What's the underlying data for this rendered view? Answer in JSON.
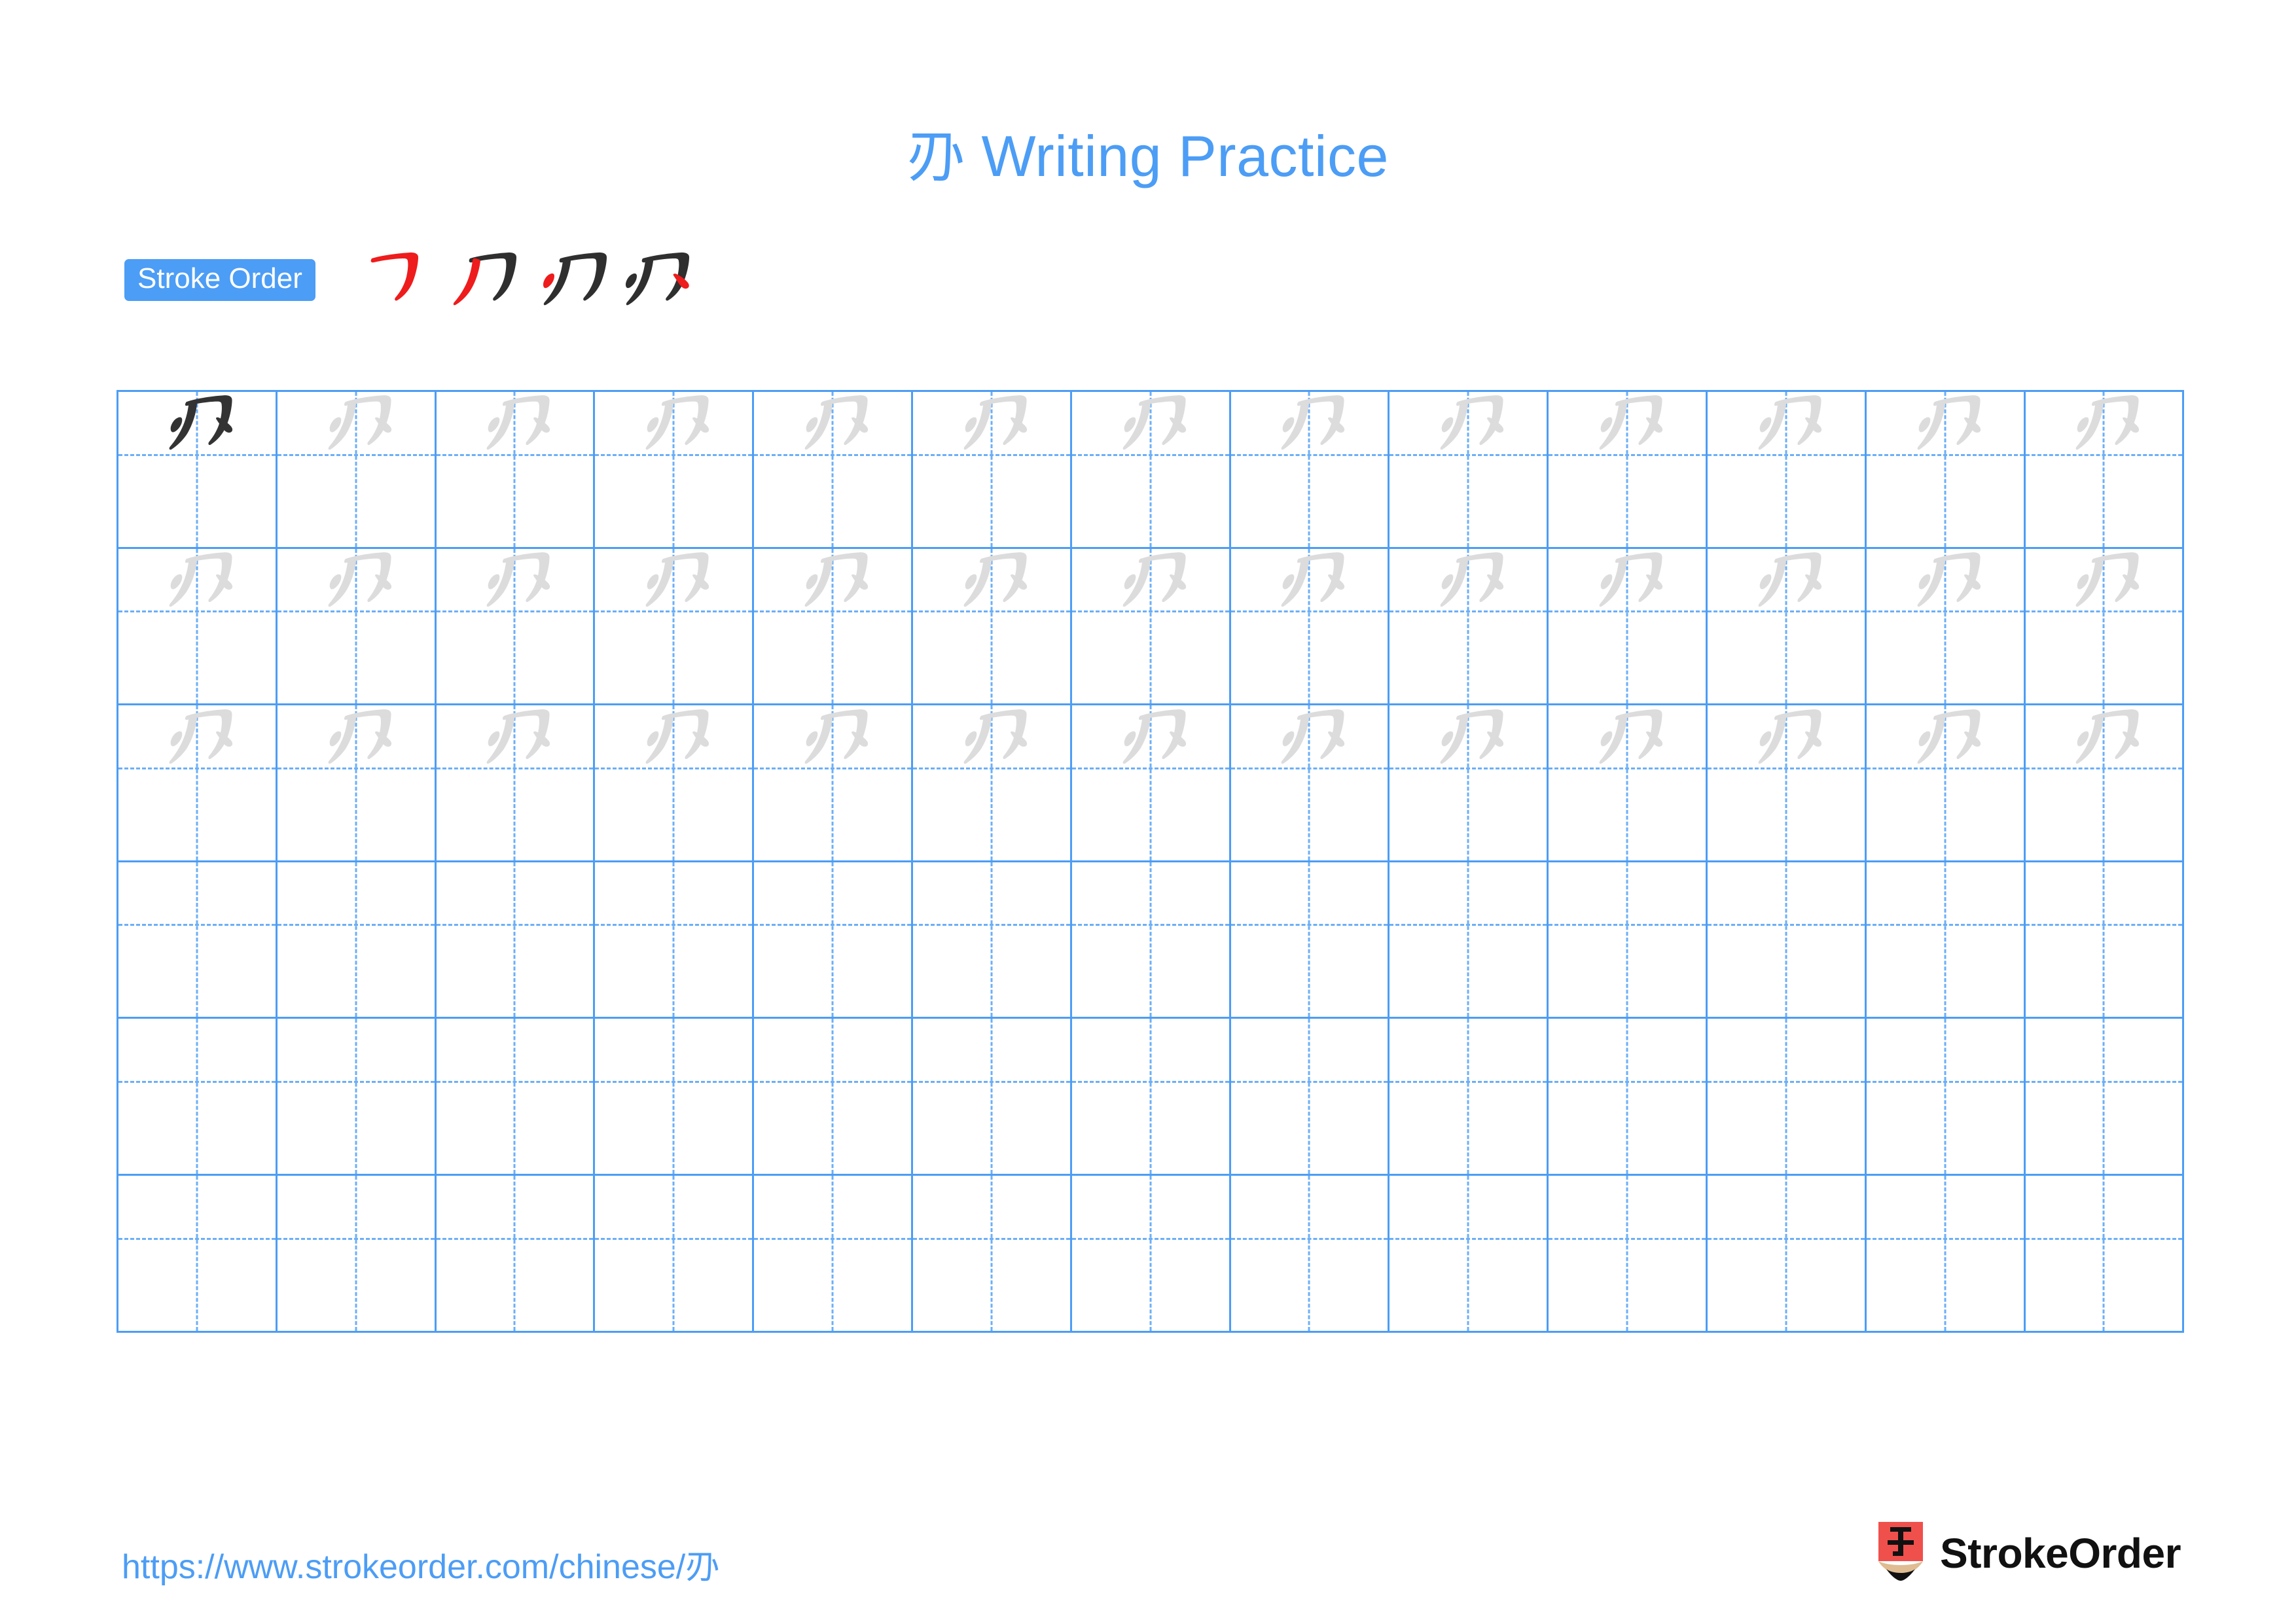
{
  "document": {
    "character": "刅",
    "title_suffix": " Writing Practice",
    "title": "刅 Writing Practice",
    "background_color": "#ffffff"
  },
  "colors": {
    "accent_blue": "#4C9DF5",
    "grid_line": "#4C9DF5",
    "grid_guide": "#6CAFF7",
    "model_char": "#333333",
    "trace_char": "#DCDCDC",
    "stroke_new": "#EE1C1C",
    "stroke_done": "#2F2F2F",
    "logo_red": "#F0504C",
    "logo_wood": "#E0BC92",
    "logo_text": "#111111"
  },
  "stroke_order": {
    "badge_label": "Stroke Order",
    "total_strokes": 4,
    "steps": [
      {
        "index": 1,
        "character": "㇀",
        "new_stroke": "heng-zhe-gou"
      },
      {
        "index": 2,
        "character": "刀",
        "new_stroke": "pie"
      },
      {
        "index": 3,
        "character": "刃",
        "new_stroke": "dian-left"
      },
      {
        "index": 4,
        "character": "刅",
        "new_stroke": "dian-right"
      }
    ]
  },
  "practice_grid": {
    "columns": 13,
    "rows": 6,
    "model_cell": {
      "row": 1,
      "column": 1,
      "character": "刅"
    },
    "trace_character": "刅",
    "filled_rows": 3,
    "empty_rows": 3,
    "row_fill": [
      [
        "model",
        "trace",
        "trace",
        "trace",
        "trace",
        "trace",
        "trace",
        "trace",
        "trace",
        "trace",
        "trace",
        "trace",
        "trace"
      ],
      [
        "trace",
        "trace",
        "trace",
        "trace",
        "trace",
        "trace",
        "trace",
        "trace",
        "trace",
        "trace",
        "trace",
        "trace",
        "trace"
      ],
      [
        "trace",
        "trace",
        "trace",
        "trace",
        "trace",
        "trace",
        "trace",
        "trace",
        "trace",
        "trace",
        "trace",
        "trace",
        "trace"
      ],
      [
        "empty",
        "empty",
        "empty",
        "empty",
        "empty",
        "empty",
        "empty",
        "empty",
        "empty",
        "empty",
        "empty",
        "empty",
        "empty"
      ],
      [
        "empty",
        "empty",
        "empty",
        "empty",
        "empty",
        "empty",
        "empty",
        "empty",
        "empty",
        "empty",
        "empty",
        "empty",
        "empty"
      ],
      [
        "empty",
        "empty",
        "empty",
        "empty",
        "empty",
        "empty",
        "empty",
        "empty",
        "empty",
        "empty",
        "empty",
        "empty",
        "empty"
      ]
    ]
  },
  "footer": {
    "url": "https://www.strokeorder.com/chinese/刅",
    "brand_name": "StrokeOrder",
    "brand_mark_character": "字"
  }
}
